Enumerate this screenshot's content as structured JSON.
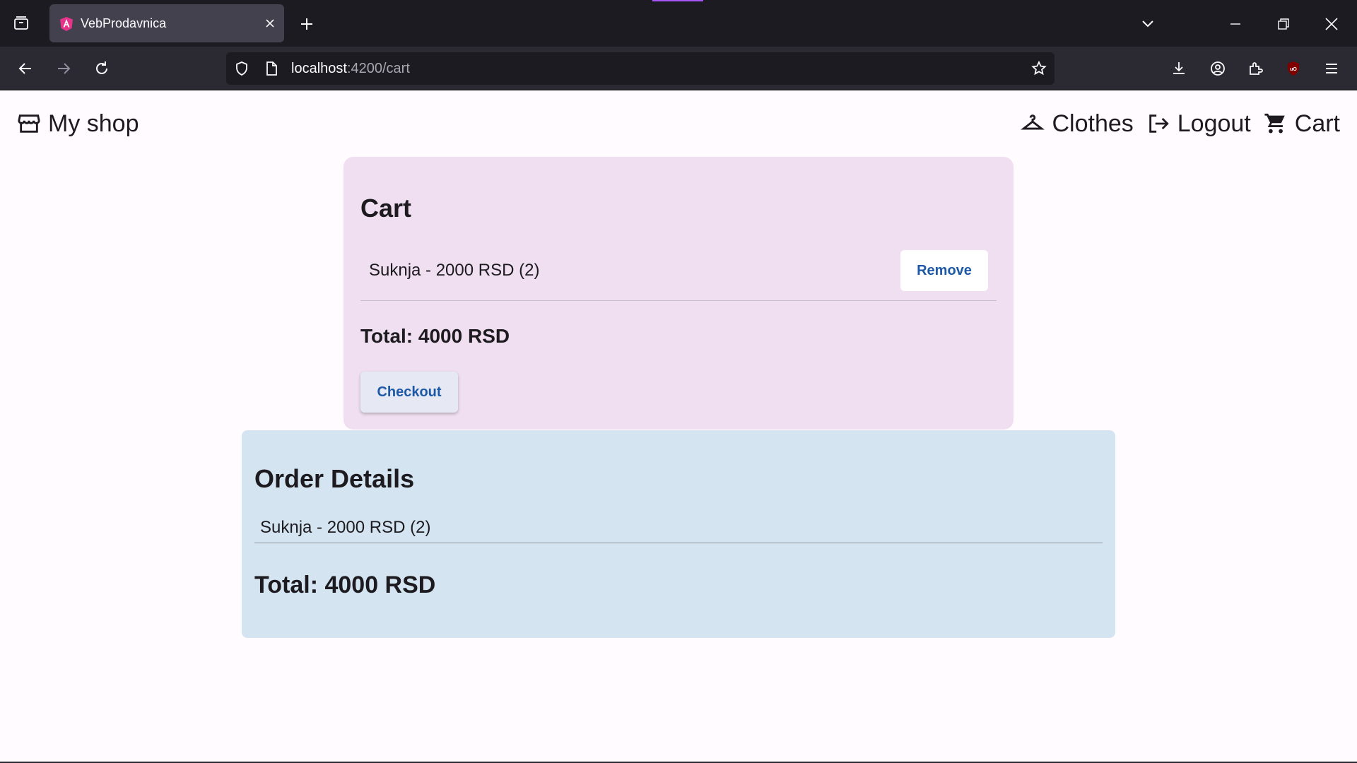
{
  "browser": {
    "tab_title": "VebProdavnica",
    "url_host": "localhost",
    "url_path": ":4200/cart",
    "accent": "#a855f7"
  },
  "header": {
    "brand": "My shop",
    "nav": [
      {
        "label": "Clothes",
        "icon": "hanger-icon"
      },
      {
        "label": "Logout",
        "icon": "logout-icon"
      },
      {
        "label": "Cart",
        "icon": "cart-icon"
      }
    ]
  },
  "cart": {
    "title": "Cart",
    "items": [
      {
        "text": "Suknja - 2000 RSD (2)",
        "remove_label": "Remove"
      }
    ],
    "total": "Total: 4000 RSD",
    "checkout_label": "Checkout",
    "background": "#efdff0"
  },
  "order": {
    "title": "Order Details",
    "items": [
      {
        "text": "Suknja - 2000 RSD (2)"
      }
    ],
    "total": "Total: 4000 RSD",
    "background": "#d4e5f1"
  }
}
